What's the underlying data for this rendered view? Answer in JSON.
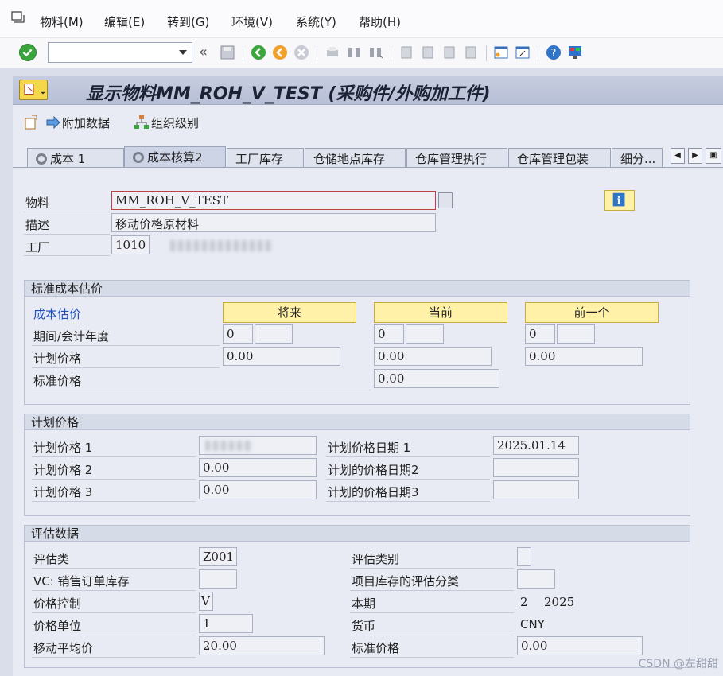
{
  "menu": {
    "items": [
      "物料(M)",
      "编辑(E)",
      "转到(G)",
      "环境(V)",
      "系统(Y)",
      "帮助(H)"
    ]
  },
  "toolbar": {
    "command_value": ""
  },
  "title": "显示物料MM_ROH_V_TEST (采购件/外购加工件)",
  "actions": {
    "additional_data": "附加数据",
    "org_levels": "组织级别"
  },
  "tabs": [
    "成本 1",
    "成本核算2",
    "工厂库存",
    "仓储地点库存",
    "仓库管理执行",
    "仓库管理包装",
    "细分..."
  ],
  "header": {
    "material_label": "物料",
    "material_value": "MM_ROH_V_TEST",
    "description_label": "描述",
    "description_value": "移动价格原材料",
    "plant_label": "工厂",
    "plant_value": "1010"
  },
  "std_cost": {
    "title": "标准成本估价",
    "row_label_cost_estimate": "成本估价",
    "row_label_period": "期间/会计年度",
    "row_label_planned": "计划价格",
    "row_label_standard": "标准价格",
    "future_btn": "将来",
    "current_btn": "当前",
    "previous_btn": "前一个",
    "future_period": "0",
    "current_period": "0",
    "previous_period": "0",
    "future_planned": "0.00",
    "current_planned": "0.00",
    "previous_planned": "0.00",
    "current_standard": "0.00"
  },
  "planned_price": {
    "title": "计划价格",
    "p1_label": "计划价格 1",
    "p2_label": "计划价格 2",
    "p3_label": "计划价格 3",
    "p2_value": "0.00",
    "p3_value": "0.00",
    "d1_label": "计划价格日期 1",
    "d2_label": "计划的价格日期2",
    "d3_label": "计划的价格日期3",
    "d1_value": "2025.01.14"
  },
  "valuation": {
    "title": "评估数据",
    "val_class_label": "评估类",
    "val_class_value": "Z001",
    "vc_label": "VC: 销售订单库存",
    "price_control_label": "价格控制",
    "price_control_value": "V",
    "price_unit_label": "价格单位",
    "price_unit_value": "1",
    "map_label": "移动平均价",
    "map_value": "20.00",
    "val_category_label": "评估类别",
    "proj_stock_label": "项目库存的评估分类",
    "current_period_label": "本期",
    "current_period_value": "2",
    "current_year_value": "2025",
    "currency_label": "货币",
    "currency_value": "CNY",
    "std_price_label": "标准价格",
    "std_price_value": "0.00"
  },
  "watermark": "CSDN @左甜甜"
}
